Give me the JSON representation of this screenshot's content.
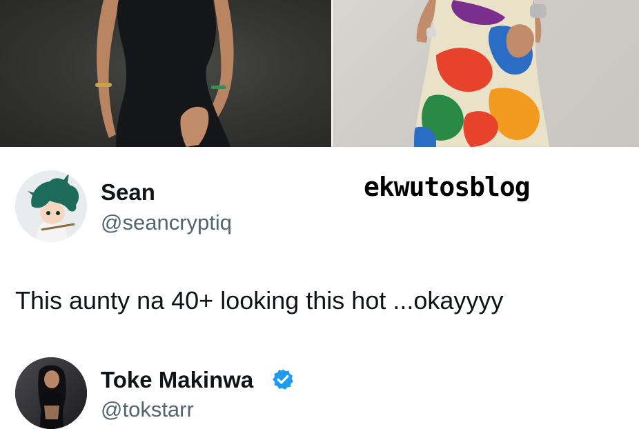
{
  "colors": {
    "text_primary": "#0f1419",
    "text_secondary": "#536471",
    "verified_blue": "#1d9bf0",
    "watermark": "#000000"
  },
  "photos": {
    "left": {
      "icon": "photo-woman-black-dress"
    },
    "right": {
      "icon": "photo-woman-patterned-dress"
    }
  },
  "watermark": {
    "text": "ekwutosblog"
  },
  "tweet": {
    "author": {
      "display_name": "Sean",
      "handle": "@seancryptiq",
      "avatar_icon": "anime-avatar"
    },
    "text": "This aunty na 40+ looking this hot ...okayyyy"
  },
  "reply": {
    "author": {
      "display_name": "Toke Makinwa",
      "handle": "@tokstarr",
      "avatar_icon": "profile-photo",
      "verified": true,
      "verified_icon": "verified-badge-icon"
    }
  }
}
